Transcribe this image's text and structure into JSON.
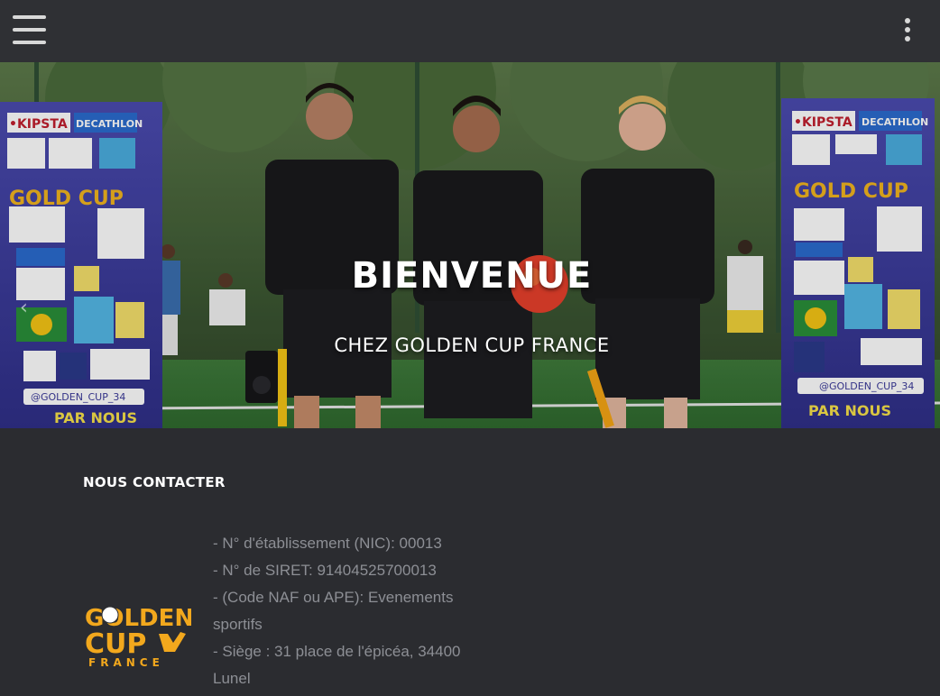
{
  "header": {
    "menu_icon": "hamburger-menu-icon",
    "more_icon": "vertical-dots-icon"
  },
  "hero": {
    "title": "BIENVENUE",
    "subtitle": "CHEZ GOLDEN CUP FRANCE",
    "prev_icon": "chevron-left-icon",
    "banner_left": {
      "brand1": "•KIPSTA",
      "brand2": "DECATHLON",
      "brand3": "KIPSTA",
      "logo_text": "GOLD CUP",
      "footer": "PAR NOUS",
      "social": "@GOLDEN_CUP_34"
    },
    "banner_right": {
      "brand1": "•KIPSTA",
      "brand2": "DECATHLON",
      "brand3": "KIPSTA",
      "logo_text": "GOLD CUP",
      "footer": "PAR NOUS",
      "social": "@GOLDEN_CUP_34"
    }
  },
  "footer": {
    "heading": "NOUS CONTACTER",
    "logo": {
      "line1": "GOLDEN",
      "line2": "CUP",
      "line3": "FRANCE"
    },
    "contact": [
      "- N° d'établissement (NIC): 00013",
      "- N° de SIRET: 91404525700013",
      "- (Code NAF ou APE): Evenements sportifs",
      "- Siège : 31 place de l'épicéa, 34400 Lunel"
    ]
  },
  "colors": {
    "header_bg": "#2f3034",
    "page_bg": "#2b2c30",
    "text_muted": "#8d8f95",
    "logo_gold": "#f2a81d",
    "banner_blue": "#3b3a9a"
  }
}
